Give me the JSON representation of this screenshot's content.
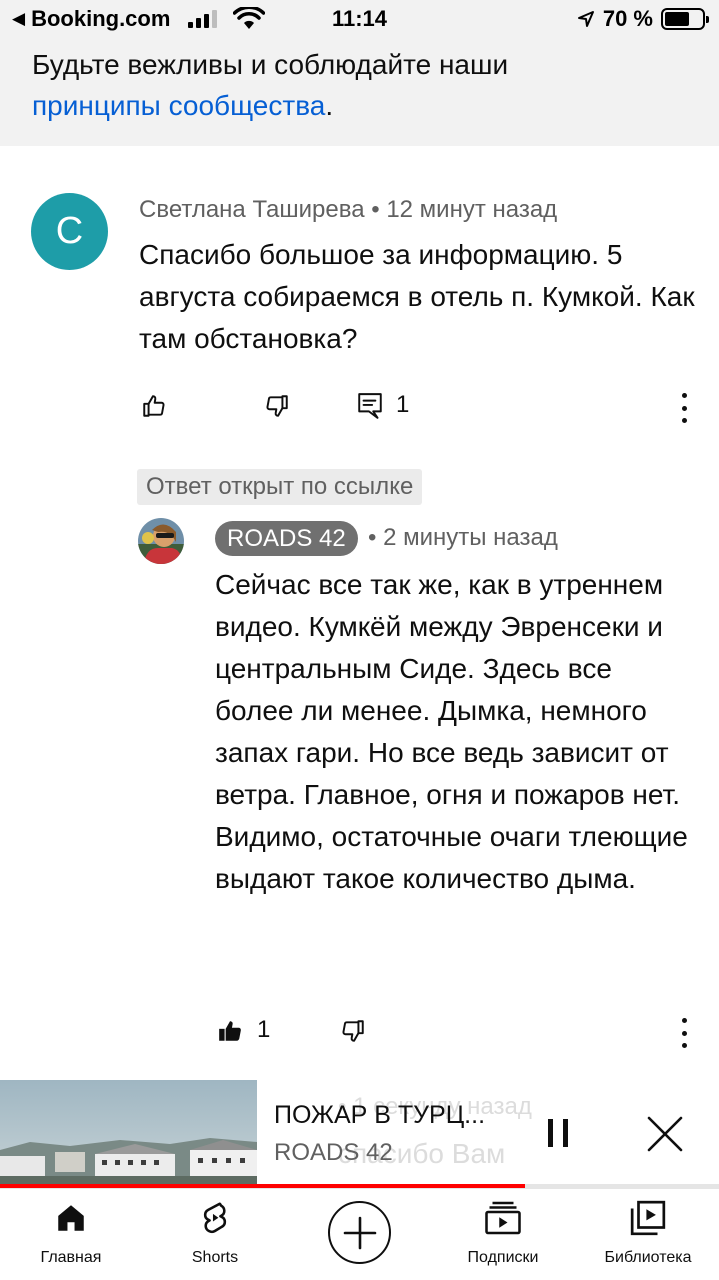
{
  "status_bar": {
    "back_app": "Booking.com",
    "back_icon": "triangle-left-icon",
    "time": "11:14",
    "battery": "70 %"
  },
  "notice": {
    "text": "Будьте вежливы и соблюдайте наши",
    "link": "принципы сообщества",
    "suffix": "."
  },
  "comment": {
    "avatar_letter": "С",
    "author": "Светлана Таширева",
    "separator": "•",
    "time": "12 минут назад",
    "text": "Спасибо большое за информацию. 5 августа собираемся в отель п. Кумкой. Как там обстановка?",
    "reply_count": "1"
  },
  "linked_label": "Ответ открыт по ссылке",
  "reply": {
    "author": "ROADS 42",
    "separator": "•",
    "time": "2 минуты назад",
    "text": "Сейчас все так же, как в утреннем видео. Кумкёй между Эвренсеки и центральным Сиде. Здесь все более ли менее. Дымка, немного запах гари. Но все ведь зависит от ветра. Главное, огня и пожаров нет. Видимо, остаточные очаги тлеющие выдают такое количество дыма.",
    "like_count": "1"
  },
  "mini_player": {
    "title": "ПОЖАР В ТУРЦ...",
    "channel": "ROADS 42",
    "ghost_time": "• 1 секунду назад",
    "ghost_text": "спасибо Вам",
    "progress": 0.73
  },
  "bottom_nav": {
    "home": "Главная",
    "shorts": "Shorts",
    "subscriptions": "Подписки",
    "library": "Библиотека"
  },
  "colors": {
    "link": "#065fd4",
    "avatar": "#1e9da8",
    "progress": "#ff0000",
    "notice_bg": "#f2f2f2"
  }
}
